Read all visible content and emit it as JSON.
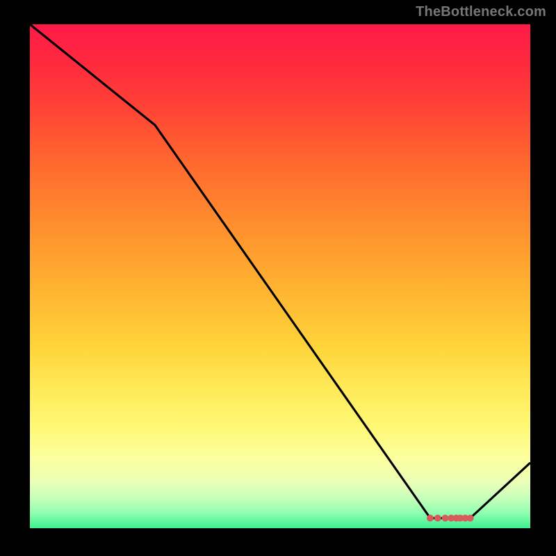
{
  "watermark": "TheBottleneck.com",
  "chart_data": {
    "type": "line",
    "title": "",
    "xlabel": "",
    "ylabel": "",
    "xlim": [
      0,
      100
    ],
    "ylim": [
      0,
      100
    ],
    "grid": false,
    "legend": false,
    "series": [
      {
        "name": "curve",
        "x": [
          0,
          25,
          80,
          88,
          100
        ],
        "y": [
          100,
          80,
          2,
          2,
          13
        ]
      }
    ],
    "markers": {
      "name": "optimal-zone-dots",
      "x": [
        80,
        81.5,
        83,
        84.2,
        85.2,
        86,
        87,
        88
      ],
      "y": [
        2,
        2,
        2,
        2,
        2,
        2,
        2,
        2
      ]
    },
    "gradient_stops": [
      {
        "pos": 0.0,
        "color": "#ff1a47"
      },
      {
        "pos": 0.8,
        "color": "#fff976"
      },
      {
        "pos": 1.0,
        "color": "#3cf08f"
      }
    ]
  }
}
